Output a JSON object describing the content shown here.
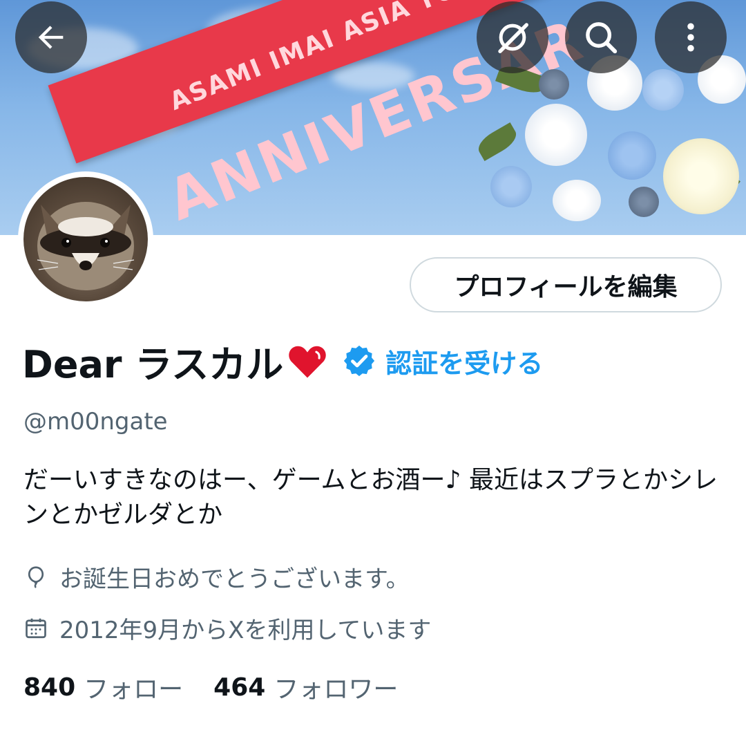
{
  "banner": {
    "ribbon_line1": "ASAMI IMAI ASIA TOUR",
    "ribbon_line2": "ANNIVERSAR"
  },
  "top_bar": {
    "back_icon": "arrow-left-icon",
    "grok_icon": "grok-icon",
    "search_icon": "search-icon",
    "more_icon": "more-vertical-icon"
  },
  "profile": {
    "edit_button_label": "プロフィールを編集",
    "display_name": "Dear ラスカル",
    "verify_link": "認証を受ける",
    "handle": "@m00ngate",
    "bio": "だーいすきなのはー、ゲームとお酒ー♪ 最近はスプラとかシレンとかゼルダとか",
    "location": "お誕生日おめでとうございます。",
    "joined": "2012年9月からXを利用しています",
    "following_count": "840",
    "following_label": "フォロー",
    "followers_count": "464",
    "followers_label": "フォロワー"
  },
  "colors": {
    "accent": "#1d9bf0",
    "text_primary": "#0f1419",
    "text_secondary": "#536471",
    "heart": "#e0142d"
  }
}
